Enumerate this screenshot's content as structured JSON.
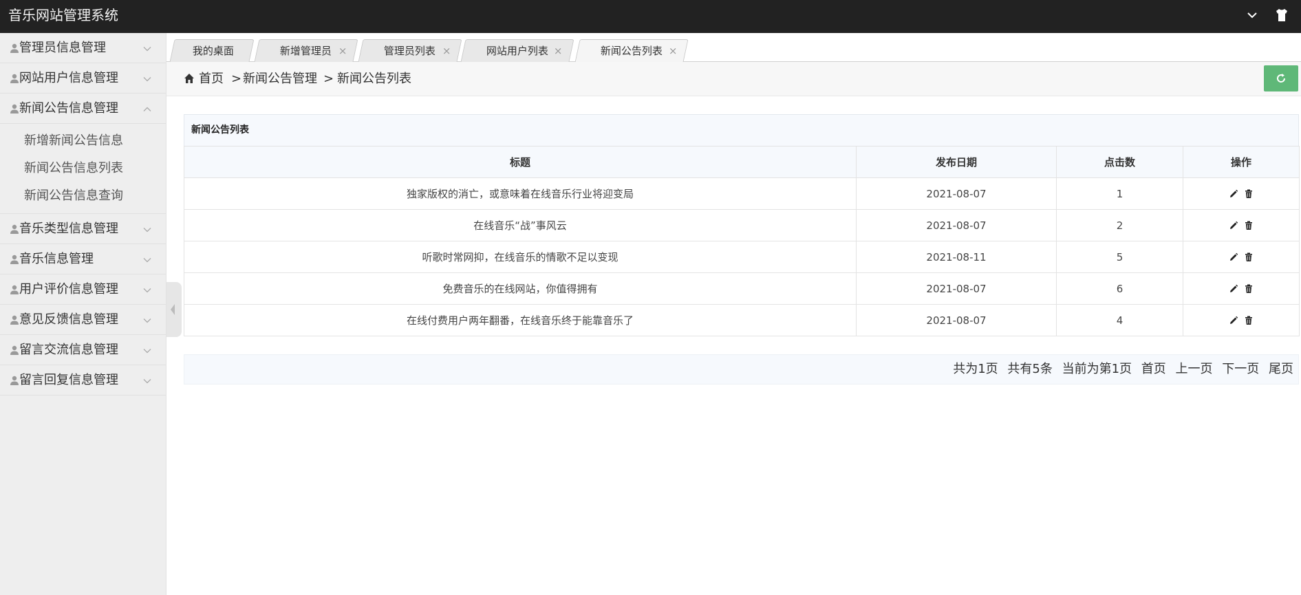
{
  "header": {
    "title": "音乐网站管理系统",
    "icons": [
      "chevron-down-icon",
      "tshirt-icon"
    ]
  },
  "sidebar": {
    "items": [
      {
        "label": "管理员信息管理",
        "expanded": false
      },
      {
        "label": "网站用户信息管理",
        "expanded": false
      },
      {
        "label": "新闻公告信息管理",
        "expanded": true
      },
      {
        "label": "音乐类型信息管理",
        "expanded": false
      },
      {
        "label": "音乐信息管理",
        "expanded": false
      },
      {
        "label": "用户评价信息管理",
        "expanded": false
      },
      {
        "label": "意见反馈信息管理",
        "expanded": false
      },
      {
        "label": "留言交流信息管理",
        "expanded": false
      },
      {
        "label": "留言回复信息管理",
        "expanded": false
      }
    ],
    "subitems": [
      "新增新闻公告信息",
      "新闻公告信息列表",
      "新闻公告信息查询"
    ]
  },
  "tabs": [
    {
      "label": "我的桌面",
      "closable": false
    },
    {
      "label": "新增管理员",
      "closable": true
    },
    {
      "label": "管理员列表",
      "closable": true
    },
    {
      "label": "网站用户列表",
      "closable": true
    },
    {
      "label": "新闻公告列表",
      "closable": true,
      "active": true
    }
  ],
  "tab_close_glyph": "×",
  "breadcrumb": {
    "home": "首页",
    "sep": ">",
    "section": "新闻公告管理",
    "page": "新闻公告列表"
  },
  "panel": {
    "title": "新闻公告列表"
  },
  "table": {
    "columns": [
      "标题",
      "发布日期",
      "点击数",
      "操作"
    ],
    "rows": [
      {
        "title": "独家版权的消亡，或意味着在线音乐行业将迎变局",
        "date": "2021-08-07",
        "clicks": "1"
      },
      {
        "title": "在线音乐“战”事风云",
        "date": "2021-08-07",
        "clicks": "2"
      },
      {
        "title": "听歌时常网抑，在线音乐的情歌不足以变现",
        "date": "2021-08-11",
        "clicks": "5"
      },
      {
        "title": "免费音乐的在线网站，你值得拥有",
        "date": "2021-08-07",
        "clicks": "6"
      },
      {
        "title": "在线付费用户两年翻番，在线音乐终于能靠音乐了",
        "date": "2021-08-07",
        "clicks": "4"
      }
    ]
  },
  "pager": {
    "total_pages": "共为1页",
    "total_items": "共有5条",
    "current": "当前为第1页",
    "first": "首页",
    "prev": "上一页",
    "next": "下一页",
    "last": "尾页"
  },
  "colors": {
    "header_bg": "#222222",
    "refresh_bg": "#5fb878",
    "sidebar_bg": "#eeeeee",
    "panel_bg": "#f6f9fd"
  }
}
